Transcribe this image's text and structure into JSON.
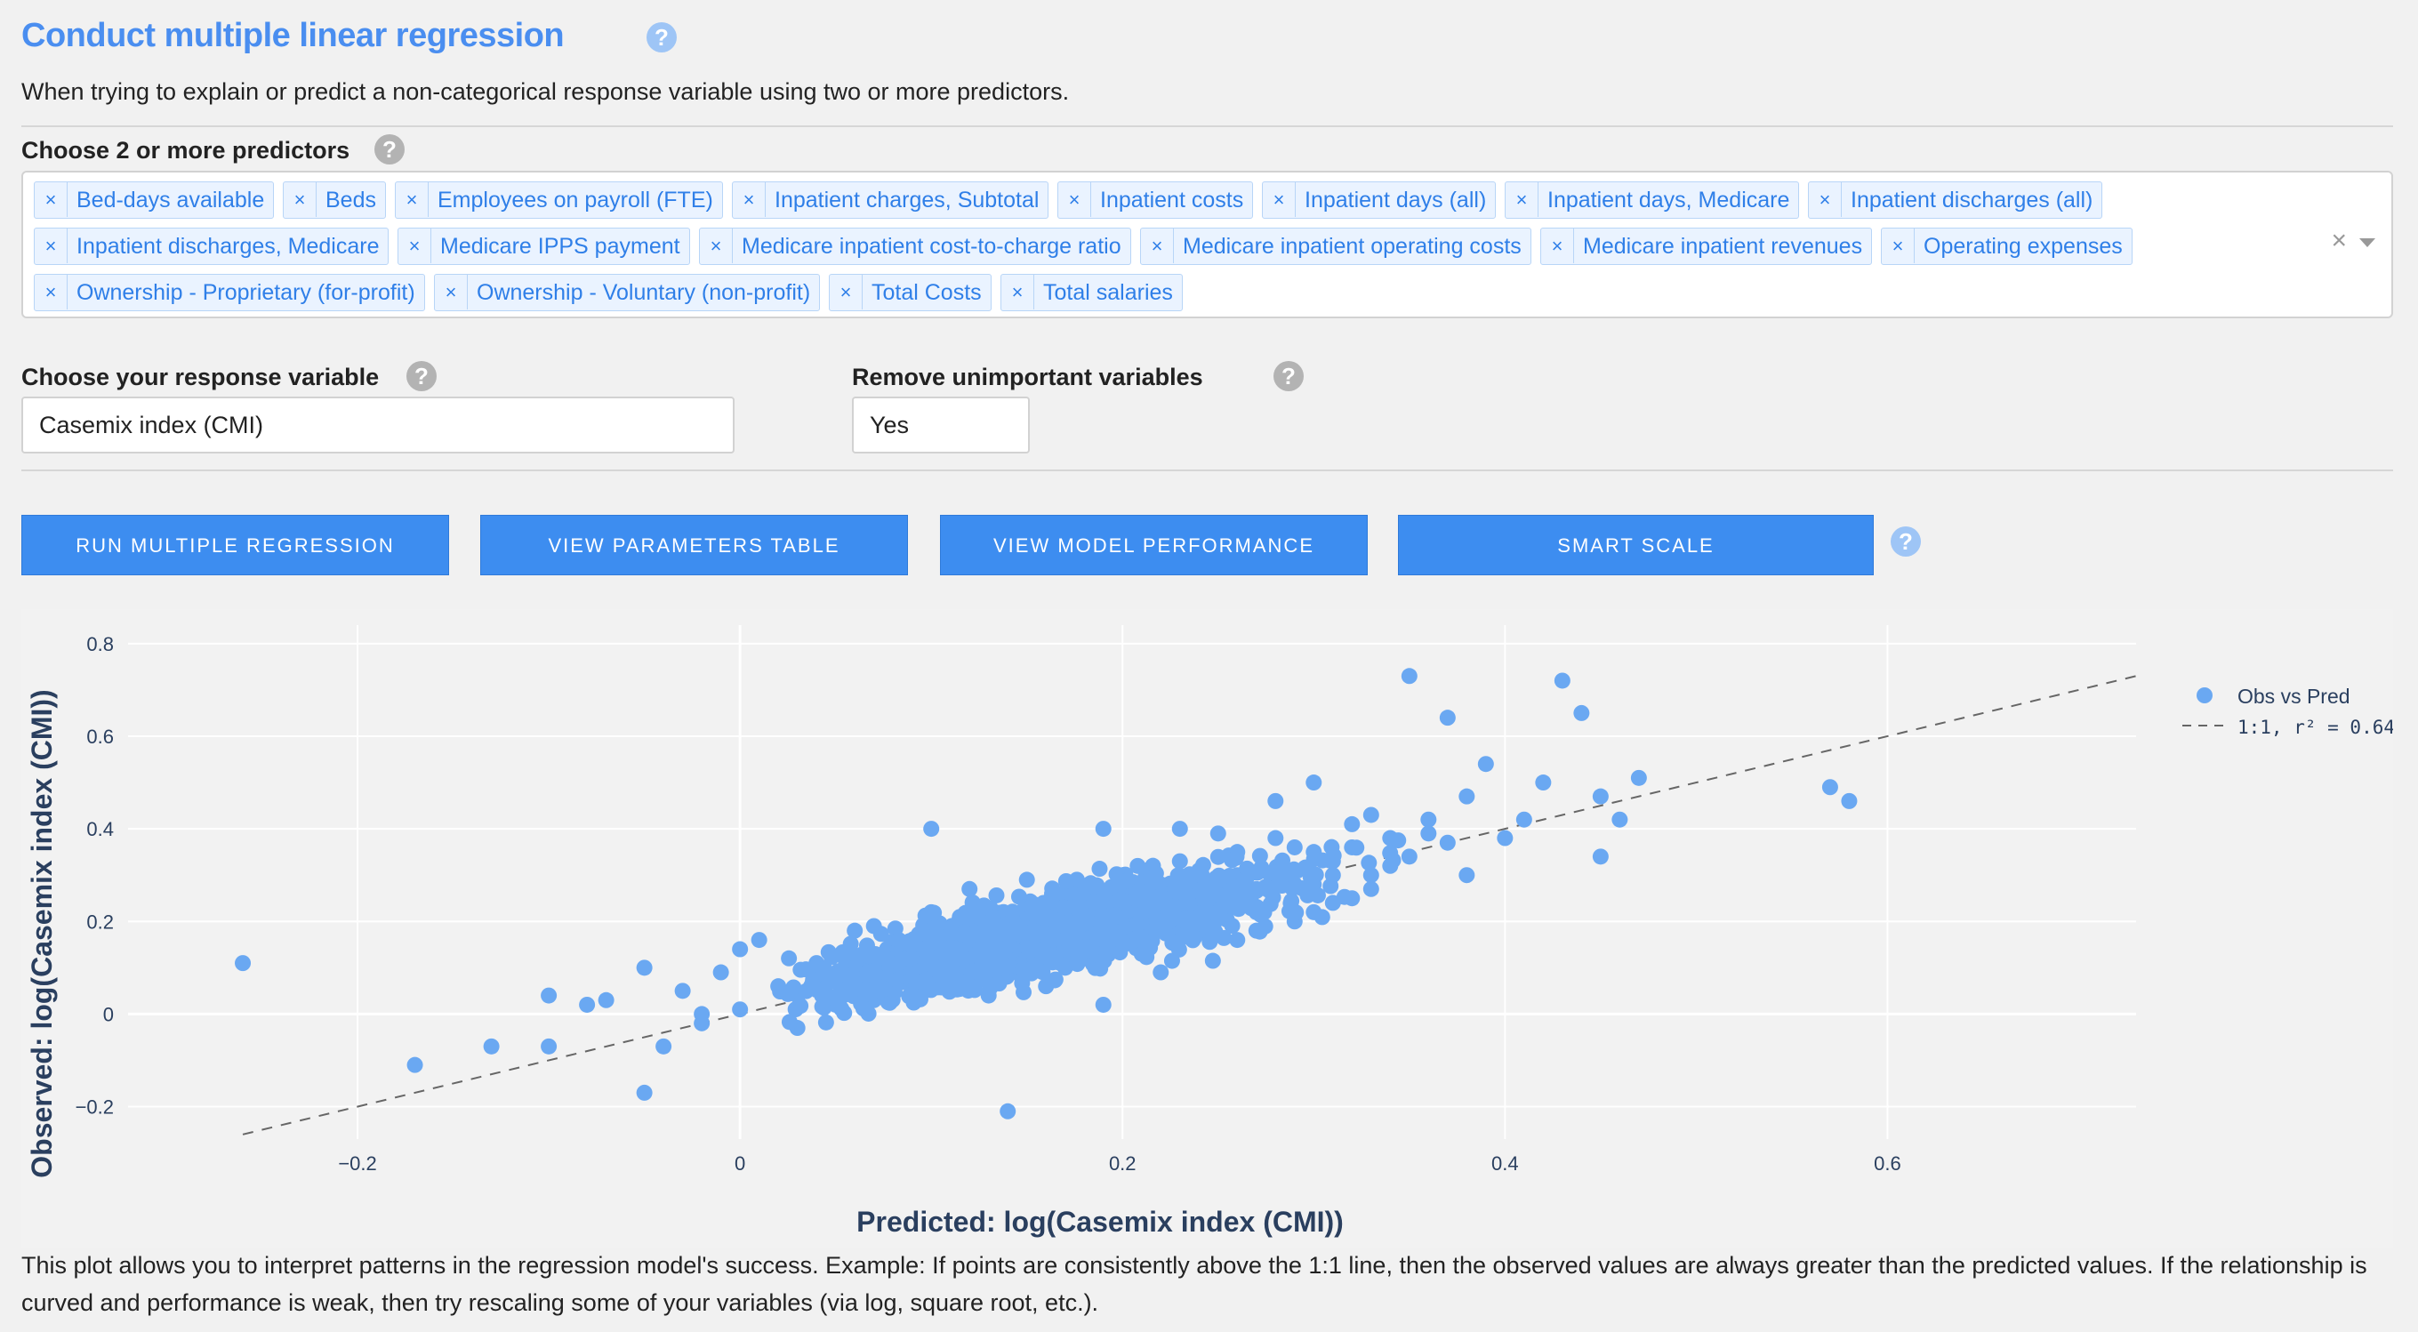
{
  "header": {
    "title": "Conduct multiple linear regression",
    "subtitle": "When trying to explain or predict a non-categorical response variable using two or more predictors."
  },
  "predictors": {
    "label": "Choose 2 or more predictors",
    "tags": [
      "Bed-days available",
      "Beds",
      "Employees on payroll (FTE)",
      "Inpatient charges, Subtotal",
      "Inpatient costs",
      "Inpatient days (all)",
      "Inpatient days, Medicare",
      "Inpatient discharges (all)",
      "Inpatient discharges, Medicare",
      "Medicare IPPS payment",
      "Medicare inpatient cost-to-charge ratio",
      "Medicare inpatient operating costs",
      "Medicare inpatient revenues",
      "Operating expenses",
      "Ownership - Proprietary (for-profit)",
      "Ownership - Voluntary (non-profit)",
      "Total Costs",
      "Total salaries"
    ]
  },
  "response": {
    "label": "Choose your response variable",
    "value": "Casemix index (CMI)"
  },
  "remove_unimportant": {
    "label": "Remove unimportant variables",
    "value": "Yes"
  },
  "buttons": {
    "run": "RUN MULTIPLE REGRESSION",
    "params": "VIEW PARAMETERS TABLE",
    "performance": "VIEW MODEL PERFORMANCE",
    "smart_scale": "SMART SCALE"
  },
  "help_glyph": "?",
  "remove_glyph": "×",
  "colors": {
    "accent": "#3d8df0",
    "points": "#6aa8f2",
    "title": "#4a8ef0"
  },
  "chart_data": {
    "type": "scatter",
    "xlabel": "Predicted:  log(Casemix index (CMI))",
    "ylabel": "Observed:  log(Casemix index (CMI))",
    "xlim": [
      -0.32,
      0.73
    ],
    "ylim": [
      -0.27,
      0.84
    ],
    "xticks": [
      -0.2,
      0,
      0.2,
      0.4,
      0.6
    ],
    "xtick_labels": [
      "−0.2",
      "0",
      "0.2",
      "0.4",
      "0.6"
    ],
    "yticks": [
      -0.2,
      0,
      0.2,
      0.4,
      0.6,
      0.8
    ],
    "ytick_labels": [
      "−0.2",
      "0",
      "0.2",
      "0.4",
      "0.6",
      "0.8"
    ],
    "grid": true,
    "legend_position": "top-right",
    "series": [
      {
        "name": "Obs vs Pred",
        "kind": "markers"
      },
      {
        "name": "1:1, r² = 0.64",
        "kind": "dashed-line",
        "x": [
          -0.26,
          0.73
        ],
        "y": [
          -0.26,
          0.73
        ]
      }
    ],
    "points": [
      [
        -0.26,
        0.11
      ],
      [
        -0.17,
        -0.11
      ],
      [
        -0.13,
        -0.07
      ],
      [
        -0.1,
        0.04
      ],
      [
        -0.1,
        -0.07
      ],
      [
        -0.08,
        0.02
      ],
      [
        -0.07,
        0.03
      ],
      [
        -0.05,
        0.1
      ],
      [
        -0.05,
        -0.17
      ],
      [
        -0.04,
        -0.07
      ],
      [
        -0.03,
        0.05
      ],
      [
        -0.02,
        0.0
      ],
      [
        -0.02,
        -0.02
      ],
      [
        -0.01,
        0.09
      ],
      [
        0.0,
        0.14
      ],
      [
        0.0,
        0.01
      ],
      [
        0.01,
        0.16
      ],
      [
        0.02,
        0.06
      ],
      [
        0.03,
        0.04
      ],
      [
        0.03,
        -0.03
      ],
      [
        0.04,
        0.11
      ],
      [
        0.05,
        0.02
      ],
      [
        0.05,
        0.08
      ],
      [
        0.06,
        0.18
      ],
      [
        0.07,
        0.03
      ],
      [
        0.07,
        0.19
      ],
      [
        0.08,
        0.06
      ],
      [
        0.09,
        0.05
      ],
      [
        0.1,
        0.4
      ],
      [
        0.1,
        0.22
      ],
      [
        0.11,
        0.08
      ],
      [
        0.12,
        0.27
      ],
      [
        0.13,
        0.04
      ],
      [
        0.14,
        0.13
      ],
      [
        0.14,
        -0.21
      ],
      [
        0.15,
        0.29
      ],
      [
        0.16,
        0.06
      ],
      [
        0.17,
        0.24
      ],
      [
        0.18,
        0.12
      ],
      [
        0.19,
        0.02
      ],
      [
        0.19,
        0.4
      ],
      [
        0.2,
        0.3
      ],
      [
        0.21,
        0.13
      ],
      [
        0.22,
        0.09
      ],
      [
        0.23,
        0.4
      ],
      [
        0.23,
        0.33
      ],
      [
        0.24,
        0.2
      ],
      [
        0.25,
        0.39
      ],
      [
        0.26,
        0.16
      ],
      [
        0.27,
        0.27
      ],
      [
        0.28,
        0.46
      ],
      [
        0.29,
        0.36
      ],
      [
        0.3,
        0.5
      ],
      [
        0.3,
        0.22
      ],
      [
        0.31,
        0.3
      ],
      [
        0.32,
        0.41
      ],
      [
        0.33,
        0.43
      ],
      [
        0.34,
        0.32
      ],
      [
        0.35,
        0.73
      ],
      [
        0.36,
        0.42
      ],
      [
        0.37,
        0.64
      ],
      [
        0.38,
        0.47
      ],
      [
        0.38,
        0.3
      ],
      [
        0.39,
        0.54
      ],
      [
        0.4,
        0.38
      ],
      [
        0.41,
        0.42
      ],
      [
        0.42,
        0.5
      ],
      [
        0.43,
        0.72
      ],
      [
        0.44,
        0.65
      ],
      [
        0.45,
        0.47
      ],
      [
        0.45,
        0.34
      ],
      [
        0.46,
        0.42
      ],
      [
        0.47,
        0.51
      ],
      [
        0.57,
        0.49
      ],
      [
        0.58,
        0.46
      ],
      [
        0.15,
        0.17
      ],
      [
        0.18,
        0.2
      ],
      [
        0.2,
        0.22
      ],
      [
        0.22,
        0.25
      ],
      [
        0.24,
        0.26
      ],
      [
        0.26,
        0.3
      ],
      [
        0.28,
        0.31
      ],
      [
        0.3,
        0.35
      ],
      [
        0.32,
        0.36
      ],
      [
        0.34,
        0.38
      ],
      [
        0.36,
        0.39
      ],
      [
        0.12,
        0.11
      ],
      [
        0.14,
        0.18
      ],
      [
        0.16,
        0.21
      ],
      [
        0.21,
        0.19
      ],
      [
        0.25,
        0.24
      ],
      [
        0.27,
        0.22
      ],
      [
        0.29,
        0.28
      ],
      [
        0.31,
        0.33
      ],
      [
        0.33,
        0.3
      ],
      [
        0.35,
        0.34
      ],
      [
        0.37,
        0.37
      ],
      [
        0.23,
        0.17
      ],
      [
        0.19,
        0.15
      ],
      [
        0.17,
        0.1
      ],
      [
        0.13,
        0.16
      ],
      [
        0.11,
        0.14
      ],
      [
        0.09,
        0.12
      ],
      [
        0.08,
        0.1
      ],
      [
        0.26,
        0.35
      ],
      [
        0.28,
        0.38
      ],
      [
        0.3,
        0.28
      ],
      [
        0.32,
        0.25
      ],
      [
        0.24,
        0.31
      ],
      [
        0.22,
        0.28
      ],
      [
        0.2,
        0.26
      ],
      [
        0.18,
        0.24
      ],
      [
        0.16,
        0.14
      ],
      [
        0.27,
        0.18
      ],
      [
        0.29,
        0.2
      ],
      [
        0.31,
        0.24
      ],
      [
        0.33,
        0.27
      ]
    ]
  },
  "caption": "This plot allows you to interpret patterns in the regression model's success. Example: If points are consistently above the 1:1 line, then the observed values are always greater than the predicted values. If the relationship is curved and performance is weak, then try rescaling some of your variables (via log, square root, etc.)."
}
